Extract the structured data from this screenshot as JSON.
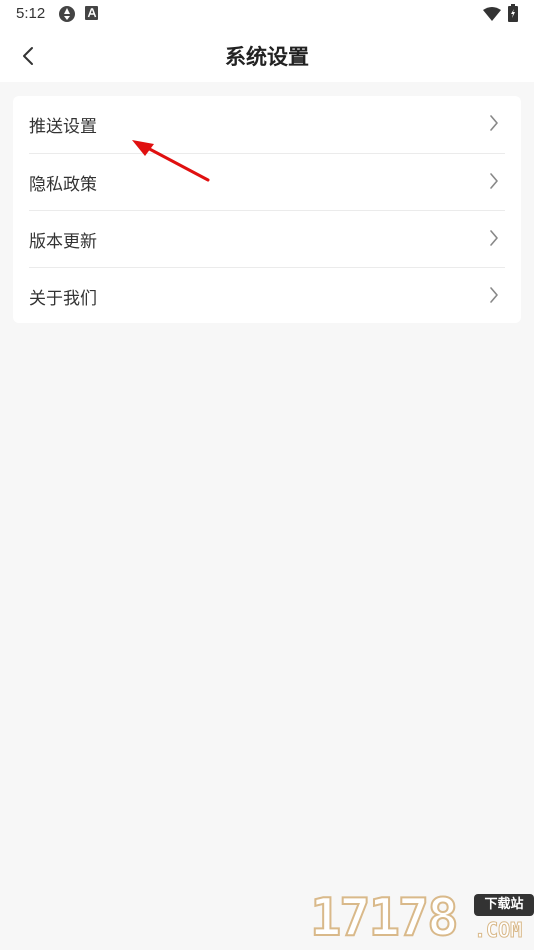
{
  "status_bar": {
    "time": "5:12"
  },
  "nav": {
    "title": "系统设置"
  },
  "settings": {
    "items": [
      {
        "label": "推送设置"
      },
      {
        "label": "隐私政策"
      },
      {
        "label": "版本更新"
      },
      {
        "label": "关于我们"
      }
    ]
  },
  "watermark": {
    "number": "17178",
    "badge": "下载站",
    "domain": ".COM"
  },
  "colors": {
    "background": "#f7f7f7",
    "card": "#ffffff",
    "annotation_arrow": "#e01010"
  }
}
